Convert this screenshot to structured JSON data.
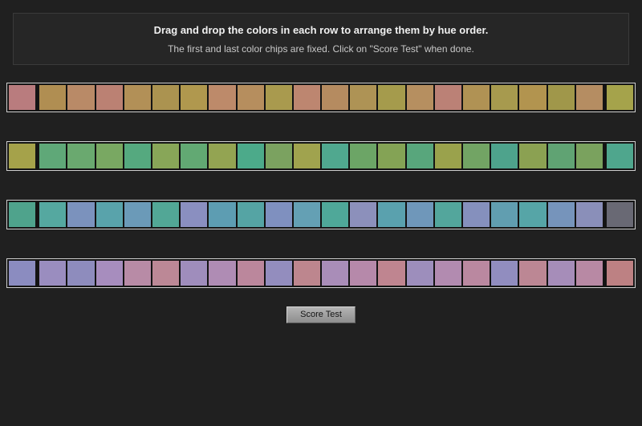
{
  "instructions": {
    "line1": "Drag and drop the colors in each row to arrange them by hue order.",
    "line2": "The first and last color chips are fixed. Click on \"Score Test\" when done."
  },
  "button": {
    "label": "Score Test"
  },
  "colors": {
    "page_background": "#202020",
    "panel_background": "#262626",
    "panel_border": "#3a3a3a",
    "row_border": "#cfcfcf",
    "row_background": "#141414",
    "button_background": "#a0a0a0",
    "button_text": "#141414"
  },
  "rows": [
    {
      "name": "row-1-red-to-olive",
      "chips": [
        "#b97c7e",
        "#b08e52",
        "#b98a67",
        "#bb8173",
        "#b29057",
        "#ab9350",
        "#b0984e",
        "#bd8a6a",
        "#b68e5e",
        "#a99a4e",
        "#bd8670",
        "#b58b60",
        "#ae9355",
        "#a59b4c",
        "#b68f60",
        "#bb8176",
        "#b09254",
        "#a79a4e",
        "#b2944f",
        "#a0974a",
        "#b58d62",
        "#a5a34b"
      ]
    },
    {
      "name": "row-2-olive-to-teal",
      "chips": [
        "#a5a24a",
        "#5fa878",
        "#6aa96f",
        "#79a862",
        "#55a97f",
        "#88a658",
        "#62a973",
        "#93a452",
        "#4caa8a",
        "#7ba260",
        "#a0a34e",
        "#50a88f",
        "#6ca566",
        "#84a355",
        "#58a67c",
        "#9aa24c",
        "#72a464",
        "#4ea38c",
        "#8ba152",
        "#60a373",
        "#7aa25e",
        "#4fa68d"
      ]
    },
    {
      "name": "row-3-teal-to-blue",
      "chips": [
        "#4fa38c",
        "#55a8a0",
        "#7b92bd",
        "#59a3ab",
        "#6b9ab8",
        "#52a796",
        "#8a8fc0",
        "#5d9db2",
        "#55a4a4",
        "#7f90bf",
        "#64a0b4",
        "#4fa899",
        "#8c90bb",
        "#5aa1ae",
        "#6f97ba",
        "#53a69c",
        "#8590bd",
        "#619eb0",
        "#56a5a7",
        "#7694bb",
        "#8a8fb9",
        "#696974"
      ]
    },
    {
      "name": "row-4-purple-to-rose",
      "chips": [
        "#8b8cc0",
        "#9a8dbf",
        "#8e8cbd",
        "#a78dbe",
        "#b88ba6",
        "#bc8896",
        "#9f8dbc",
        "#af8cb4",
        "#bb879c",
        "#938dbe",
        "#bd868e",
        "#a98db8",
        "#b689aa",
        "#bf8590",
        "#9d8ebc",
        "#b28bb0",
        "#ba88a0",
        "#918dbf",
        "#bc8794",
        "#a68db9",
        "#b889a4",
        "#bd8183"
      ]
    }
  ]
}
